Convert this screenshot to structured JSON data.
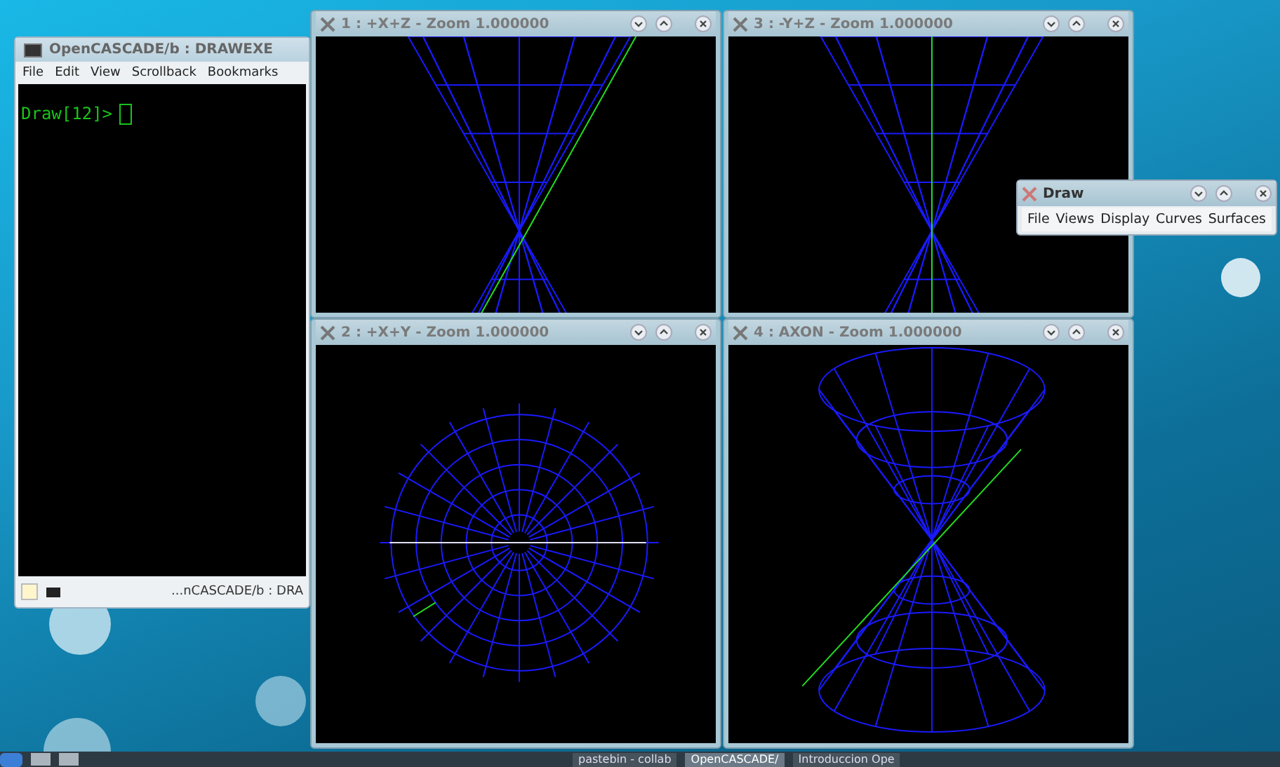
{
  "terminal": {
    "title": "OpenCASCADE/b : DRAWEXE",
    "menu": [
      "File",
      "Edit",
      "View",
      "Scrollback",
      "Bookmarks"
    ],
    "prompt": "Draw[12]>",
    "tab_label": "...nCASCADE/b : DRA"
  },
  "views": [
    {
      "title": "1 : +X+Z - Zoom 1.000000",
      "kind": "xz"
    },
    {
      "title": "3 : -Y+Z - Zoom 1.000000",
      "kind": "yz"
    },
    {
      "title": "2 : +X+Y - Zoom 1.000000",
      "kind": "xy"
    },
    {
      "title": "4 : AXON - Zoom 1.000000",
      "kind": "axon"
    }
  ],
  "draw_window": {
    "title": "Draw",
    "menu": [
      "File",
      "Views",
      "Display",
      "Curves",
      "Surfaces"
    ]
  },
  "taskbar": {
    "tasks": [
      {
        "label": "pastebin - collab",
        "selected": false
      },
      {
        "label": "OpenCASCADE/",
        "selected": true
      },
      {
        "label": "Introduccion Ope",
        "selected": false
      }
    ]
  }
}
